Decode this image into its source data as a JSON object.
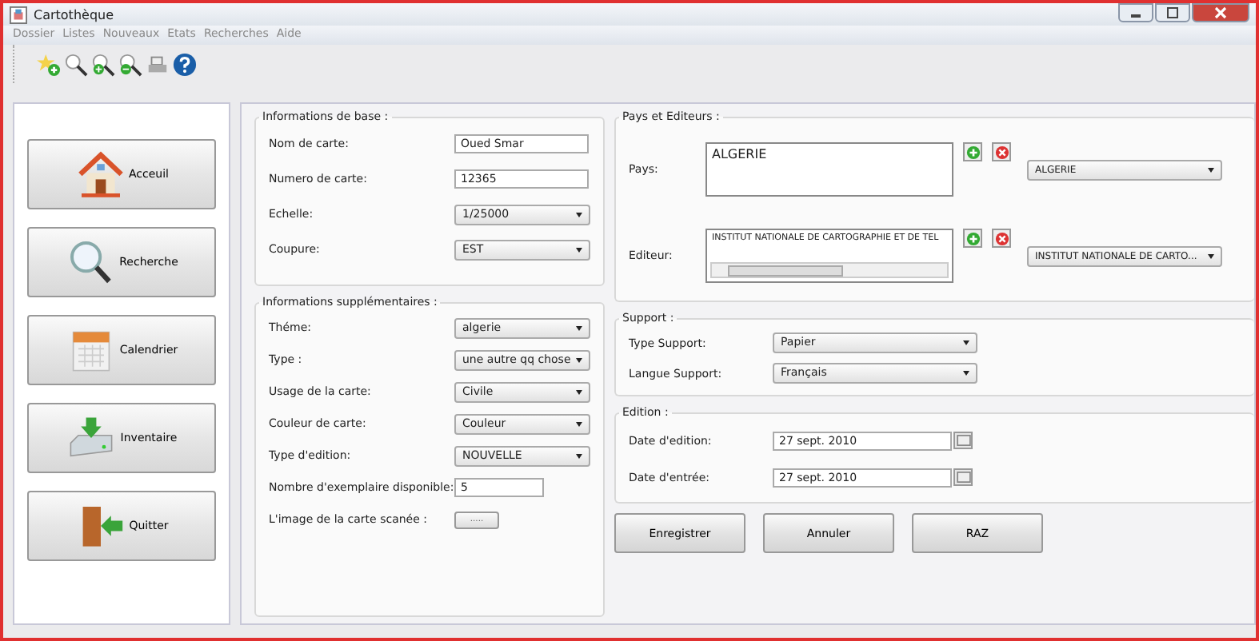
{
  "window": {
    "title": "Cartothèque"
  },
  "menu": [
    "Dossier",
    "Listes",
    "Nouveaux",
    "Etats",
    "Recherches",
    "Aide"
  ],
  "nav": [
    {
      "label": "Acceuil",
      "kind": "house"
    },
    {
      "label": "Recherche",
      "kind": "search"
    },
    {
      "label": "Calendrier",
      "kind": "calendar"
    },
    {
      "label": "Inventaire",
      "kind": "drive"
    },
    {
      "label": "Quitter",
      "kind": "exit"
    }
  ],
  "base": {
    "title": "Informations de base :",
    "fields": [
      {
        "label": "Nom de carte:",
        "kind": "text",
        "value": "Oued Smar"
      },
      {
        "label": "Numero de carte:",
        "kind": "text",
        "value": "12365"
      },
      {
        "label": "Echelle:",
        "kind": "select",
        "value": "1/25000"
      },
      {
        "label": "Coupure:",
        "kind": "select",
        "value": "EST"
      }
    ]
  },
  "supp": {
    "title": "Informations supplémentaires :",
    "fields": [
      {
        "label": "Théme:",
        "kind": "select",
        "value": "algerie"
      },
      {
        "label": "Type :",
        "kind": "select",
        "value": "une autre qq chose"
      },
      {
        "label": "Usage de la carte:",
        "kind": "select",
        "value": "Civile"
      },
      {
        "label": "Couleur de carte:",
        "kind": "select",
        "value": "Couleur"
      },
      {
        "label": "Type d'edition:",
        "kind": "select",
        "value": "NOUVELLE"
      },
      {
        "label": "Nombre d'exemplaire disponible:",
        "kind": "short",
        "value": "5"
      },
      {
        "label": "L'image de la carte scanée :",
        "kind": "browse",
        "value": "....."
      }
    ]
  },
  "pays": {
    "title": "Pays et Editeurs :",
    "rows": [
      {
        "label": "Pays:",
        "list": "ALGERIE",
        "scroll": false,
        "combo": "ALGERIE"
      },
      {
        "label": "Editeur:",
        "list": "INSTITUT NATIONALE DE CARTOGRAPHIE ET DE TEL",
        "scroll": true,
        "combo": "INSTITUT NATIONALE DE CARTO..."
      }
    ]
  },
  "support": {
    "title": "Support :",
    "fields": [
      {
        "label": "Type Support:",
        "kind": "select",
        "value": "Papier"
      },
      {
        "label": "Langue Support:",
        "kind": "select",
        "value": "Français"
      }
    ]
  },
  "edition": {
    "title": "Edition :",
    "fields": [
      {
        "label": "Date d'edition:",
        "kind": "date",
        "value": "27 sept. 2010"
      },
      {
        "label": "Date d'entrée:",
        "kind": "date",
        "value": "27 sept. 2010"
      }
    ]
  },
  "buttons": [
    "Enregistrer",
    "Annuler",
    "RAZ"
  ]
}
